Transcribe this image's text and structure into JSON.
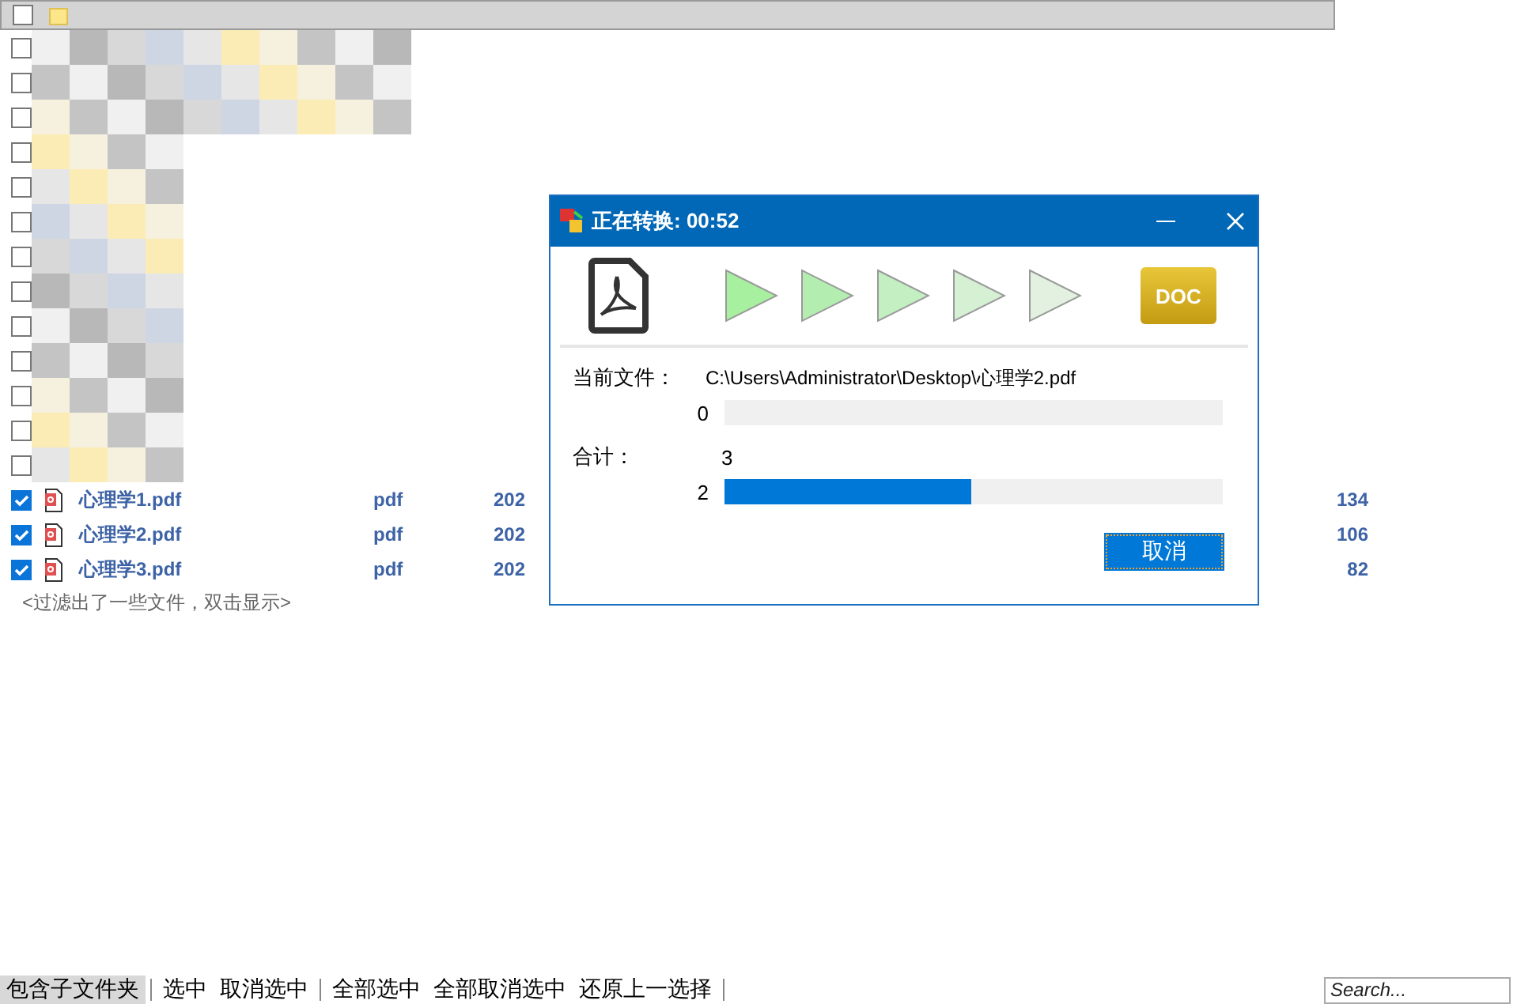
{
  "header_row": {
    "checked": false
  },
  "blurred_rows": [
    {
      "checked": false
    },
    {
      "checked": false
    },
    {
      "checked": false
    },
    {
      "checked": false
    },
    {
      "checked": false
    },
    {
      "checked": false
    },
    {
      "checked": false
    },
    {
      "checked": false
    },
    {
      "checked": false
    },
    {
      "checked": false
    },
    {
      "checked": false
    },
    {
      "checked": false
    },
    {
      "checked": false
    }
  ],
  "files": [
    {
      "name": "心理学1.pdf",
      "type": "pdf",
      "date": "202",
      "size": "134",
      "checked": true
    },
    {
      "name": "心理学2.pdf",
      "type": "pdf",
      "date": "202",
      "size": "106",
      "checked": true
    },
    {
      "name": "心理学3.pdf",
      "type": "pdf",
      "date": "202",
      "size": "82",
      "checked": true
    }
  ],
  "filter_hint": "<过滤出了一些文件，双击显示>",
  "toolbar": [
    {
      "label": "包含子文件夹",
      "selected": true
    },
    {
      "label": "选中",
      "selected": false
    },
    {
      "label": "取消选中",
      "selected": false
    },
    {
      "label": "全部选中",
      "selected": false
    },
    {
      "label": "全部取消选中",
      "selected": false
    },
    {
      "label": "还原上一选择",
      "selected": false
    }
  ],
  "search": {
    "placeholder": "Search..."
  },
  "dialog": {
    "title": "正在转换: 00:52",
    "target_badge": "DOC",
    "current_label": "当前文件：",
    "current_file": "C:\\Users\\Administrator\\Desktop\\心理学2.pdf",
    "file_progress": {
      "count": "0",
      "level": 0
    },
    "total_label": "合计：",
    "total": "3",
    "total_progress": {
      "count": "2",
      "level": 0.495
    },
    "cancel": "取消"
  }
}
